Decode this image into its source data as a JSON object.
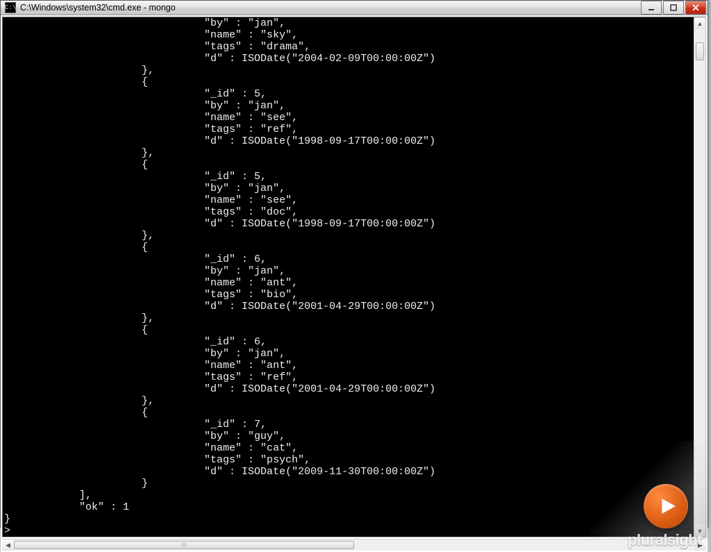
{
  "window": {
    "title": "C:\\Windows\\system32\\cmd.exe - mongo",
    "icon_label": "C:\\"
  },
  "records": [
    {
      "_id": null,
      "by": "jan",
      "name": "sky",
      "tags": "drama",
      "d": "2004-02-09T00:00:00Z",
      "partial_top": true
    },
    {
      "_id": 5,
      "by": "jan",
      "name": "see",
      "tags": "ref",
      "d": "1998-09-17T00:00:00Z"
    },
    {
      "_id": 5,
      "by": "jan",
      "name": "see",
      "tags": "doc",
      "d": "1998-09-17T00:00:00Z"
    },
    {
      "_id": 6,
      "by": "jan",
      "name": "ant",
      "tags": "bio",
      "d": "2001-04-29T00:00:00Z"
    },
    {
      "_id": 6,
      "by": "jan",
      "name": "ant",
      "tags": "ref",
      "d": "2001-04-29T00:00:00Z"
    },
    {
      "_id": 7,
      "by": "guy",
      "name": "cat",
      "tags": "psych",
      "d": "2009-11-30T00:00:00Z",
      "last": true
    }
  ],
  "footer": {
    "close_array": "],",
    "ok_key": "\"ok\"",
    "ok_value": 1,
    "close_brace": "}",
    "prompt": ">"
  },
  "watermark": "pluralsight"
}
